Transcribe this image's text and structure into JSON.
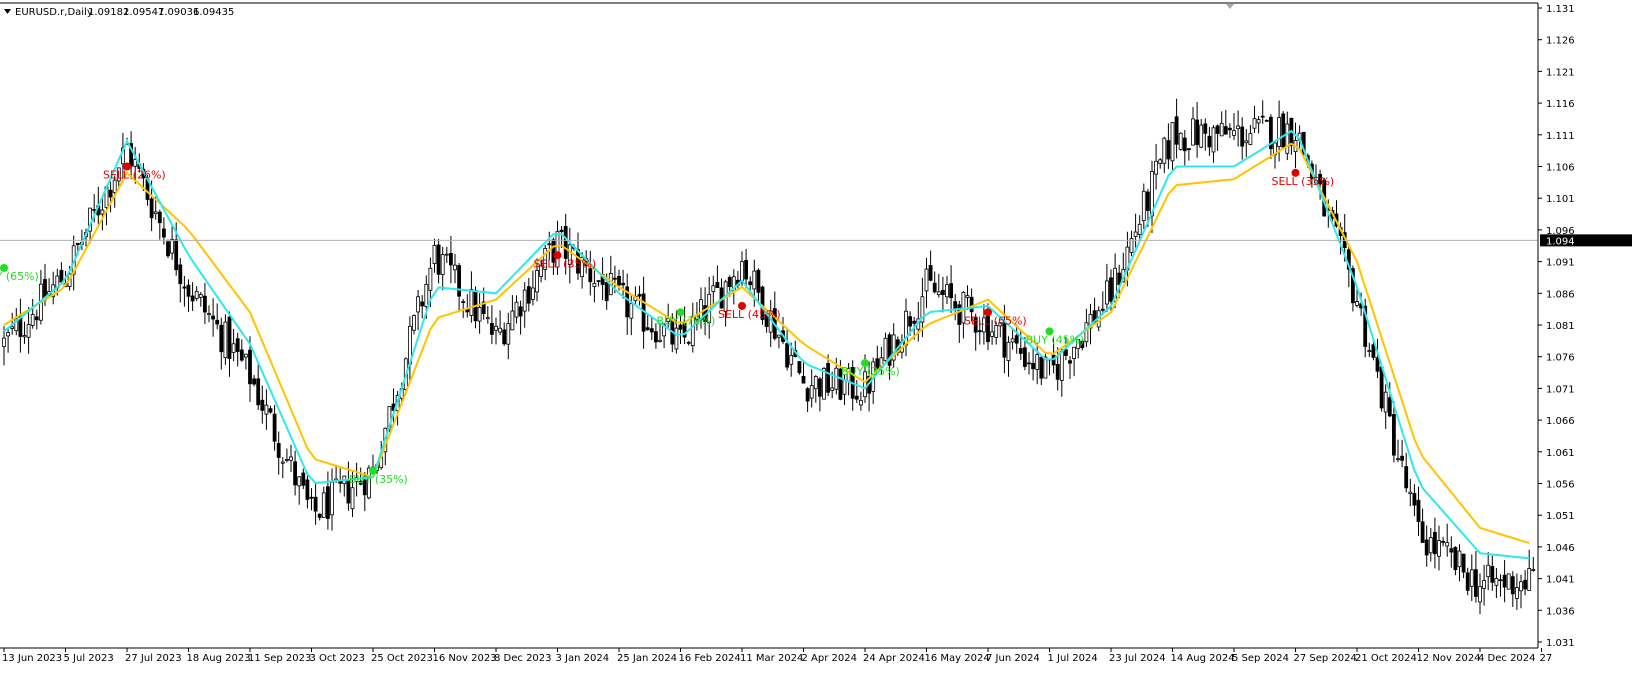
{
  "header": {
    "symbol": "EURUSD.r",
    "timeframe": "Daily",
    "open": "1.09182",
    "high": "1.09547",
    "low": "1.09036",
    "close": "1.09435"
  },
  "current_price_label": "1.094",
  "colors": {
    "background": "#ffffff",
    "candle_bull": "#ffffff",
    "candle_bear": "#000000",
    "fast_ma": "#2ee8ec",
    "slow_ma": "#ffc400",
    "sell_signal": "#e00000",
    "buy_signal": "#1ee01e",
    "current_price_line": "#b0b0b0"
  },
  "icons": {
    "collapse": "triangle-down-icon",
    "scroll_marker": "triangle-down-icon"
  },
  "price_axis": {
    "labels": [
      "1.131",
      "1.126",
      "1.121",
      "1.116",
      "1.111",
      "1.106",
      "1.101",
      "1.096",
      "1.091",
      "1.086",
      "1.081",
      "1.076",
      "1.071",
      "1.066",
      "1.061",
      "1.056",
      "1.051",
      "1.046",
      "1.041",
      "1.036",
      "1.031"
    ]
  },
  "time_axis": {
    "labels": [
      "13 Jun 2023",
      "5 Jul 2023",
      "27 Jul 2023",
      "18 Aug 2023",
      "11 Sep 2023",
      "3 Oct 2023",
      "25 Oct 2023",
      "16 Nov 2023",
      "8 Dec 2023",
      "3 Jan 2024",
      "25 Jan 2024",
      "16 Feb 2024",
      "11 Mar 2024",
      "2 Apr 2024",
      "24 Apr 2024",
      "16 May 2024",
      "7 Jun 2024",
      "1 Jul 2024",
      "23 Jul 2024",
      "14 Aug 2024",
      "5 Sep 2024",
      "27 Sep 2024",
      "21 Oct 2024",
      "12 Nov 2024",
      "4 Dec 2024",
      "27"
    ]
  },
  "chart_data": {
    "type": "candlestick",
    "symbol": "EURUSD.r",
    "timeframe": "Daily",
    "ylim": [
      1.031,
      1.131
    ],
    "grid": false,
    "x": [
      "13 Jun 2023",
      "5 Jul 2023",
      "27 Jul 2023",
      "18 Aug 2023",
      "11 Sep 2023",
      "3 Oct 2023",
      "25 Oct 2023",
      "16 Nov 2023",
      "8 Dec 2023",
      "3 Jan 2024",
      "25 Jan 2024",
      "16 Feb 2024",
      "11 Mar 2024",
      "2 Apr 2024",
      "24 Apr 2024",
      "16 May 2024",
      "7 Jun 2024",
      "1 Jul 2024",
      "23 Jul 2024",
      "14 Aug 2024",
      "5 Sep 2024",
      "27 Sep 2024",
      "21 Oct 2024",
      "12 Nov 2024",
      "4 Dec 2024",
      "27"
    ],
    "close": [
      1.078,
      1.089,
      1.109,
      1.087,
      1.073,
      1.051,
      1.058,
      1.092,
      1.079,
      1.094,
      1.085,
      1.078,
      1.091,
      1.072,
      1.071,
      1.087,
      1.081,
      1.073,
      1.086,
      1.111,
      1.111,
      1.112,
      1.085,
      1.048,
      1.04,
      1.041
    ],
    "series": [
      {
        "values": [
          1.08,
          1.088,
          1.11,
          1.092,
          1.078,
          1.056,
          1.057,
          1.087,
          1.086,
          1.096,
          1.086,
          1.079,
          1.088,
          1.075,
          1.071,
          1.083,
          1.084,
          1.075,
          1.084,
          1.106,
          1.106,
          1.112,
          1.087,
          1.056,
          1.045,
          1.044
        ]
      },
      {
        "values": [
          1.081,
          1.087,
          1.105,
          1.096,
          1.083,
          1.06,
          1.057,
          1.082,
          1.085,
          1.094,
          1.087,
          1.081,
          1.087,
          1.078,
          1.072,
          1.081,
          1.085,
          1.076,
          1.083,
          1.103,
          1.104,
          1.11,
          1.091,
          1.061,
          1.049,
          1.046
        ]
      }
    ],
    "signals": [
      {
        "label": "BUY (65%)",
        "type": "buy",
        "date": "13 Jun 2023",
        "price": 1.09
      },
      {
        "label": "SELL (26%)",
        "type": "sell",
        "date": "27 Jul 2023",
        "price": 1.106
      },
      {
        "label": "BUY (35%)",
        "type": "buy",
        "date": "25 Oct 2023",
        "price": 1.058
      },
      {
        "label": "SELL (35%)",
        "type": "sell",
        "date": "3 Jan 2024",
        "price": 1.092
      },
      {
        "label": "BUY (74%)",
        "type": "buy",
        "date": "16 Feb 2024",
        "price": 1.083
      },
      {
        "label": "SELL (45%)",
        "type": "sell",
        "date": "11 Mar 2024",
        "price": 1.084
      },
      {
        "label": "BUY (35%)",
        "type": "buy",
        "date": "24 Apr 2024",
        "price": 1.075
      },
      {
        "label": "SELL (65%)",
        "type": "sell",
        "date": "7 Jun 2024",
        "price": 1.083
      },
      {
        "label": "BUY (45%)",
        "type": "buy",
        "date": "1 Jul 2024",
        "price": 1.08
      },
      {
        "label": "SELL (35%)",
        "type": "sell",
        "date": "27 Sep 2024",
        "price": 1.105
      }
    ]
  }
}
